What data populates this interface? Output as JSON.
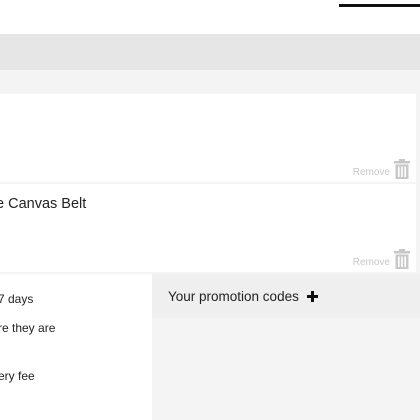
{
  "cart": {
    "items": [
      {
        "name": "",
        "remove_label": "Remove"
      },
      {
        "name": "e Canvas Belt",
        "remove_label": "Remove"
      }
    ]
  },
  "delivery_info": {
    "line1": "7 days",
    "line2": "re they are",
    "line3": "ery fee"
  },
  "promo": {
    "label": "Your promotion codes"
  }
}
